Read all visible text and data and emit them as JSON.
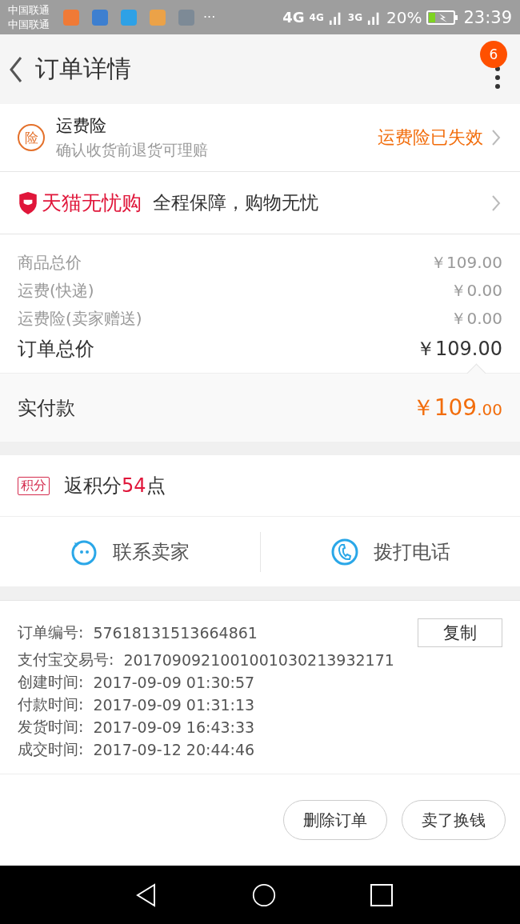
{
  "status_bar": {
    "carriers": [
      "中国联通",
      "中国联通"
    ],
    "notification_icons": [
      {
        "color": "#f07a36"
      },
      {
        "color": "#3d7fd0"
      },
      {
        "color": "#2ea1e6"
      },
      {
        "color": "#eba248"
      },
      {
        "color": "#7d8a96"
      }
    ],
    "more": "···",
    "network_labels": [
      "4G",
      "4G",
      "3G"
    ],
    "battery_percent": "20%",
    "charging": true,
    "time": "23:39"
  },
  "header": {
    "title": "订单详情",
    "badge": "6"
  },
  "insurance": {
    "icon_char": "险",
    "title": "运费险",
    "subtitle": "确认收货前退货可理赔",
    "status": "运费险已失效"
  },
  "guarantee": {
    "brand": "天猫无忧购",
    "text": "全程保障，购物无忧"
  },
  "prices": [
    {
      "label": "商品总价",
      "value": "￥109.00"
    },
    {
      "label": "运费(快递)",
      "value": "￥0.00"
    },
    {
      "label": "运费险(卖家赠送)",
      "value": "￥0.00"
    }
  ],
  "order_total": {
    "label": "订单总价",
    "value": "￥109.00"
  },
  "paid": {
    "label": "实付款",
    "amount": "￥109",
    "decimal": ".00"
  },
  "points": {
    "tag": "积分",
    "prefix": "返积分",
    "value": "54",
    "suffix": "点"
  },
  "contact_buttons": [
    {
      "kind": "chat",
      "label": "联系卖家"
    },
    {
      "kind": "phone",
      "label": "拨打电话"
    }
  ],
  "order_info": {
    "copy_button": "复制",
    "rows": [
      {
        "label": "订单编号:",
        "value": "57618131513664861"
      },
      {
        "label": "支付宝交易号:",
        "value": "2017090921001001030213932171"
      },
      {
        "label": "创建时间:",
        "value": "2017-09-09 01:30:57"
      },
      {
        "label": "付款时间:",
        "value": "2017-09-09 01:31:13"
      },
      {
        "label": "发货时间:",
        "value": "2017-09-09 16:43:33"
      },
      {
        "label": "成交时间:",
        "value": "2017-09-12 20:44:46"
      }
    ]
  },
  "actions": [
    "删除订单",
    "卖了换钱"
  ]
}
